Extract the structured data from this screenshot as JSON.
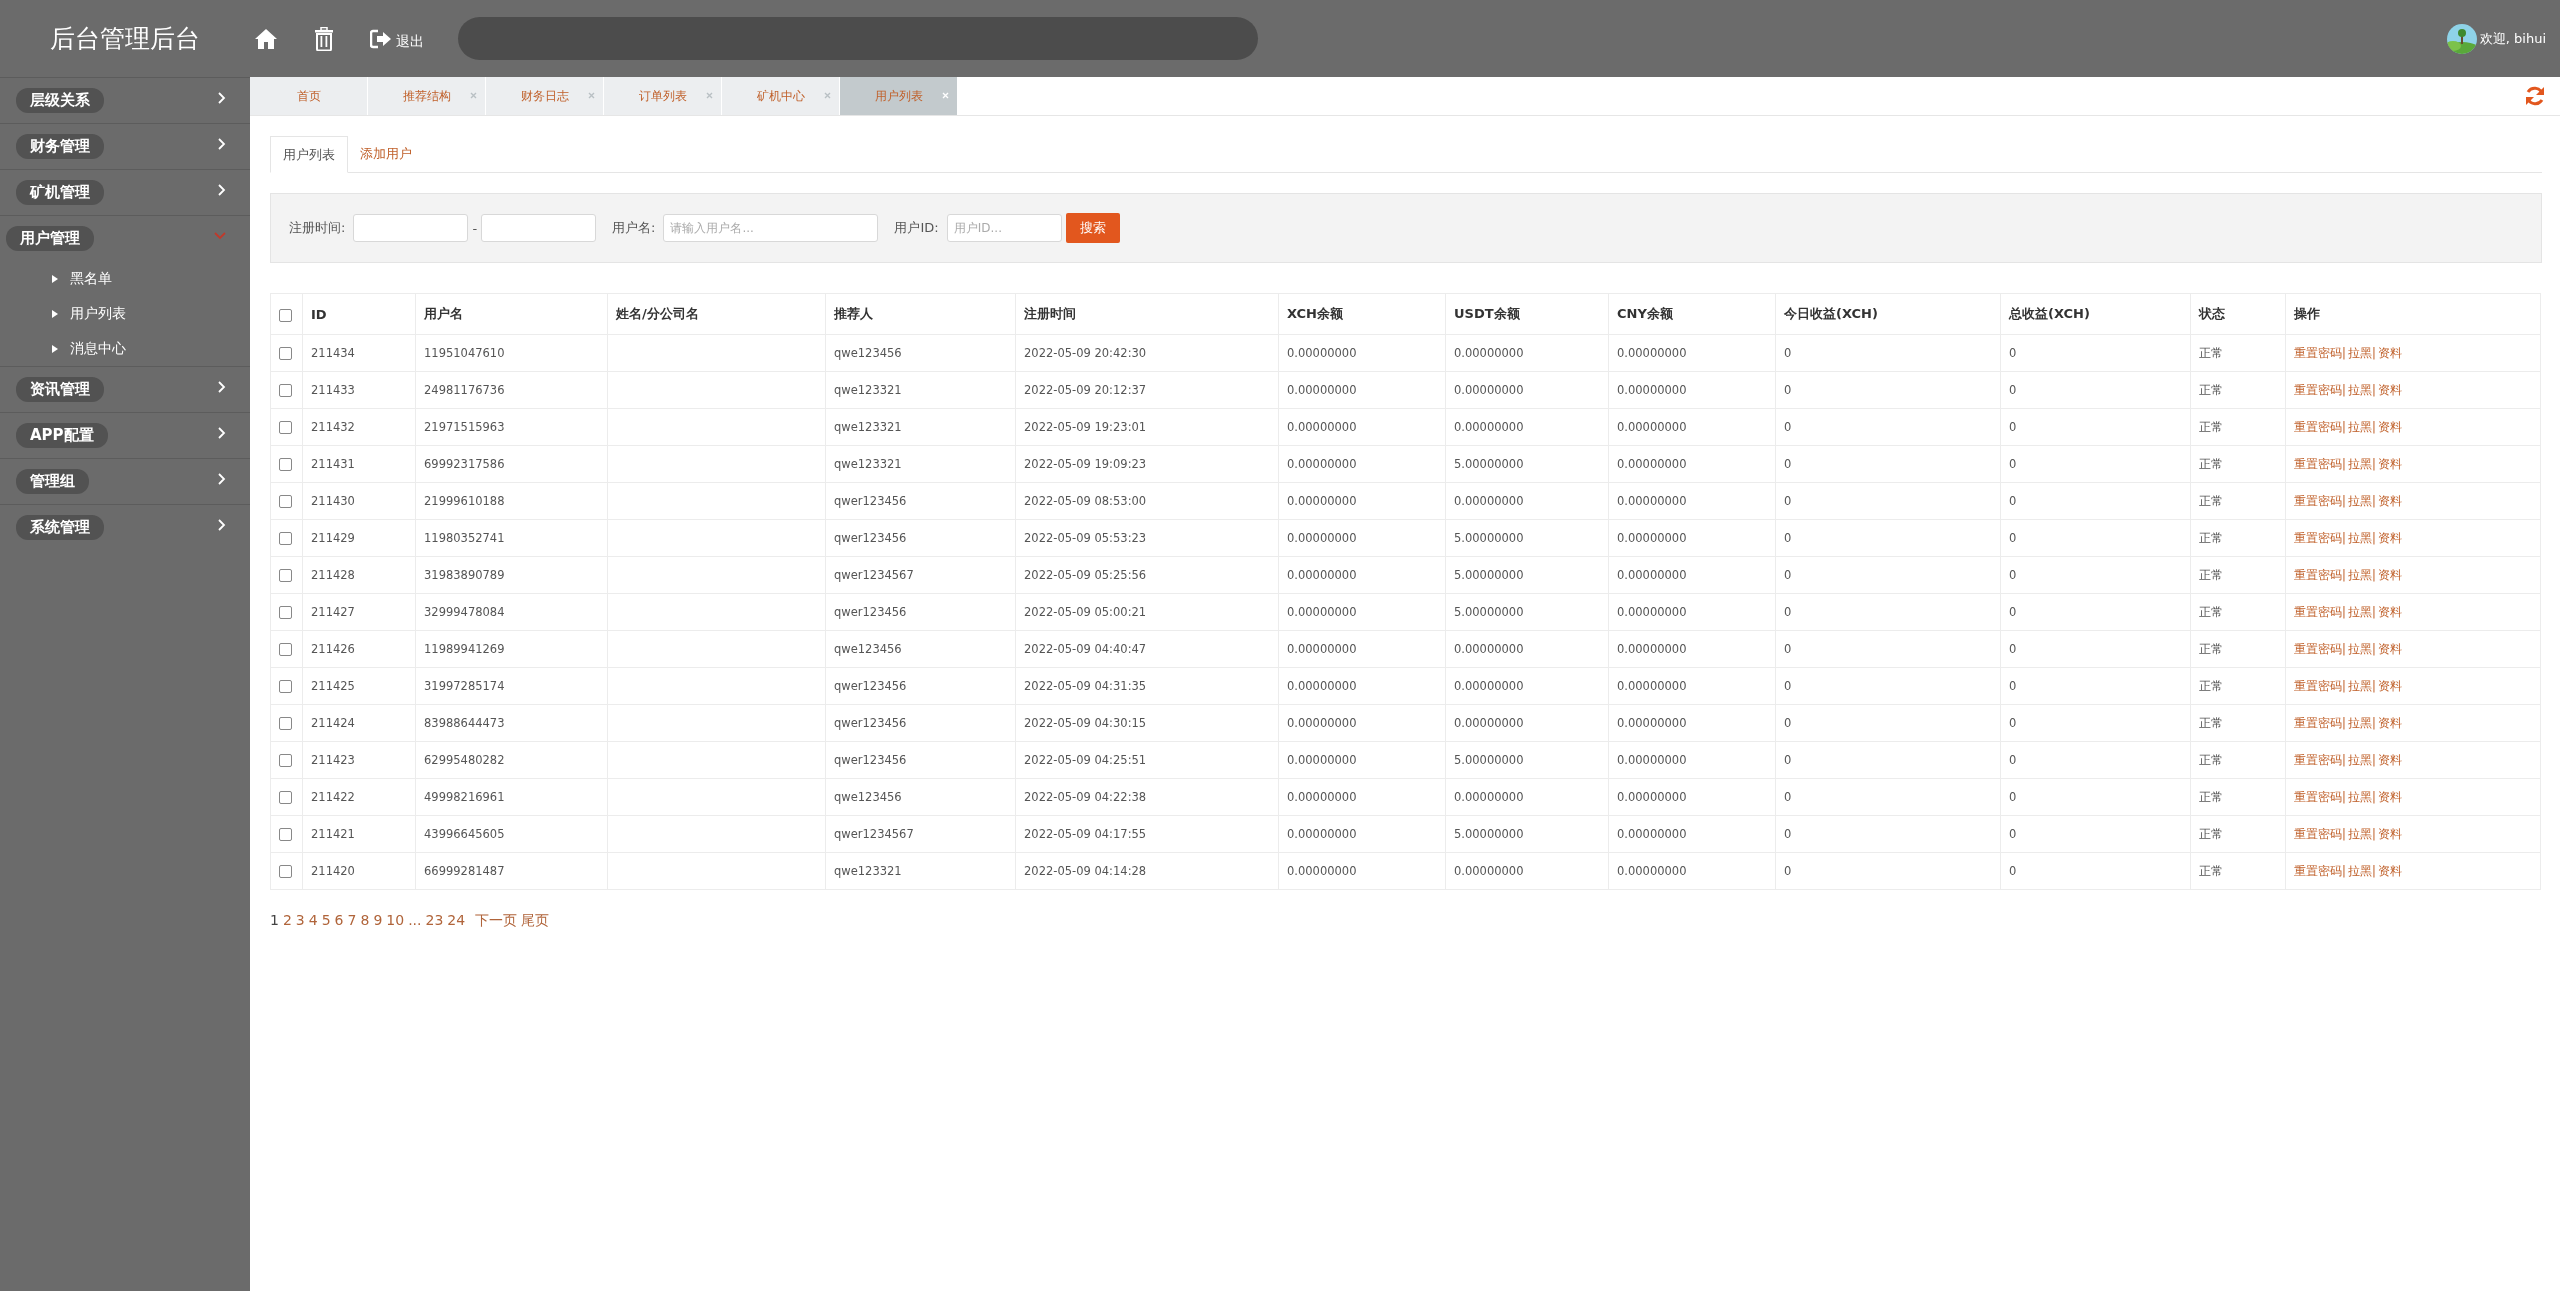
{
  "header": {
    "title": "后台管理后台",
    "logout": "退出",
    "user": "欢迎, bihui"
  },
  "sidebar": {
    "items": [
      {
        "label": "层级关系",
        "expanded": false
      },
      {
        "label": "财务管理",
        "expanded": false
      },
      {
        "label": "矿机管理",
        "expanded": false
      },
      {
        "label": "用户管理",
        "expanded": true,
        "children": [
          {
            "label": "黑名单"
          },
          {
            "label": "用户列表"
          },
          {
            "label": "消息中心"
          }
        ]
      },
      {
        "label": "资讯管理",
        "expanded": false
      },
      {
        "label": "APP配置",
        "expanded": false
      },
      {
        "label": "管理组",
        "expanded": false
      },
      {
        "label": "系统管理",
        "expanded": false
      }
    ]
  },
  "page_tabs": [
    {
      "label": "首页",
      "selected": false,
      "closable": false
    },
    {
      "label": "推荐结构",
      "selected": false,
      "closable": true
    },
    {
      "label": "财务日志",
      "selected": false,
      "closable": true
    },
    {
      "label": "订单列表",
      "selected": false,
      "closable": true
    },
    {
      "label": "矿机中心",
      "selected": false,
      "closable": true
    },
    {
      "label": "用户列表",
      "selected": true,
      "closable": true
    }
  ],
  "sub_tabs": [
    {
      "label": "用户列表",
      "selected": true
    },
    {
      "label": "添加用户",
      "selected": false
    }
  ],
  "filters": {
    "date_label": "注册时间:",
    "date_sep": "-",
    "name_label": "用户名:",
    "name_placeholder": "请输入用户名...",
    "id_label": "用户ID:",
    "id_placeholder": "用户ID...",
    "search": "搜索"
  },
  "table": {
    "all_checked": false,
    "columns": [
      "ID",
      "用户名",
      "姓名/分公司名",
      "推荐人",
      "注册时间",
      "XCH余额",
      "USDT余额",
      "CNY余额",
      "今日收益(XCH)",
      "总收益(XCH)",
      "状态",
      "操作"
    ],
    "rows": [
      {
        "checked": false,
        "cells": [
          "211434",
          "11951047610",
          "",
          "qwe123456",
          "2022-05-09 20:42:30",
          "0.00000000",
          "0.00000000",
          "0.00000000",
          "0",
          "0",
          "正常"
        ],
        "actions": [
          "重置密码|",
          "拉黑|",
          "资料"
        ]
      },
      {
        "checked": false,
        "cells": [
          "211433",
          "24981176736",
          "",
          "qwe123321",
          "2022-05-09 20:12:37",
          "0.00000000",
          "0.00000000",
          "0.00000000",
          "0",
          "0",
          "正常"
        ],
        "actions": [
          "重置密码|",
          "拉黑|",
          "资料"
        ]
      },
      {
        "checked": false,
        "cells": [
          "211432",
          "21971515963",
          "",
          "qwe123321",
          "2022-05-09 19:23:01",
          "0.00000000",
          "0.00000000",
          "0.00000000",
          "0",
          "0",
          "正常"
        ],
        "actions": [
          "重置密码|",
          "拉黑|",
          "资料"
        ]
      },
      {
        "checked": false,
        "cells": [
          "211431",
          "69992317586",
          "",
          "qwe123321",
          "2022-05-09 19:09:23",
          "0.00000000",
          "5.00000000",
          "0.00000000",
          "0",
          "0",
          "正常"
        ],
        "actions": [
          "重置密码|",
          "拉黑|",
          "资料"
        ]
      },
      {
        "checked": false,
        "cells": [
          "211430",
          "21999610188",
          "",
          "qwer123456",
          "2022-05-09 08:53:00",
          "0.00000000",
          "0.00000000",
          "0.00000000",
          "0",
          "0",
          "正常"
        ],
        "actions": [
          "重置密码|",
          "拉黑|",
          "资料"
        ]
      },
      {
        "checked": false,
        "cells": [
          "211429",
          "11980352741",
          "",
          "qwer123456",
          "2022-05-09 05:53:23",
          "0.00000000",
          "5.00000000",
          "0.00000000",
          "0",
          "0",
          "正常"
        ],
        "actions": [
          "重置密码|",
          "拉黑|",
          "资料"
        ]
      },
      {
        "checked": false,
        "cells": [
          "211428",
          "31983890789",
          "",
          "qwer1234567",
          "2022-05-09 05:25:56",
          "0.00000000",
          "5.00000000",
          "0.00000000",
          "0",
          "0",
          "正常"
        ],
        "actions": [
          "重置密码|",
          "拉黑|",
          "资料"
        ]
      },
      {
        "checked": false,
        "cells": [
          "211427",
          "32999478084",
          "",
          "qwer123456",
          "2022-05-09 05:00:21",
          "0.00000000",
          "5.00000000",
          "0.00000000",
          "0",
          "0",
          "正常"
        ],
        "actions": [
          "重置密码|",
          "拉黑|",
          "资料"
        ]
      },
      {
        "checked": false,
        "cells": [
          "211426",
          "11989941269",
          "",
          "qwe123456",
          "2022-05-09 04:40:47",
          "0.00000000",
          "0.00000000",
          "0.00000000",
          "0",
          "0",
          "正常"
        ],
        "actions": [
          "重置密码|",
          "拉黑|",
          "资料"
        ]
      },
      {
        "checked": false,
        "cells": [
          "211425",
          "31997285174",
          "",
          "qwer123456",
          "2022-05-09 04:31:35",
          "0.00000000",
          "0.00000000",
          "0.00000000",
          "0",
          "0",
          "正常"
        ],
        "actions": [
          "重置密码|",
          "拉黑|",
          "资料"
        ]
      },
      {
        "checked": false,
        "cells": [
          "211424",
          "83988644473",
          "",
          "qwer123456",
          "2022-05-09 04:30:15",
          "0.00000000",
          "0.00000000",
          "0.00000000",
          "0",
          "0",
          "正常"
        ],
        "actions": [
          "重置密码|",
          "拉黑|",
          "资料"
        ]
      },
      {
        "checked": false,
        "cells": [
          "211423",
          "62995480282",
          "",
          "qwer123456",
          "2022-05-09 04:25:51",
          "0.00000000",
          "5.00000000",
          "0.00000000",
          "0",
          "0",
          "正常"
        ],
        "actions": [
          "重置密码|",
          "拉黑|",
          "资料"
        ]
      },
      {
        "checked": false,
        "cells": [
          "211422",
          "49998216961",
          "",
          "qwe123456",
          "2022-05-09 04:22:38",
          "0.00000000",
          "0.00000000",
          "0.00000000",
          "0",
          "0",
          "正常"
        ],
        "actions": [
          "重置密码|",
          "拉黑|",
          "资料"
        ]
      },
      {
        "checked": false,
        "cells": [
          "211421",
          "43996645605",
          "",
          "qwer1234567",
          "2022-05-09 04:17:55",
          "0.00000000",
          "5.00000000",
          "0.00000000",
          "0",
          "0",
          "正常"
        ],
        "actions": [
          "重置密码|",
          "拉黑|",
          "资料"
        ]
      },
      {
        "checked": false,
        "cells": [
          "211420",
          "66999281487",
          "",
          "qwe123321",
          "2022-05-09 04:14:28",
          "0.00000000",
          "0.00000000",
          "0.00000000",
          "0",
          "0",
          "正常"
        ],
        "actions": [
          "重置密码|",
          "拉黑|",
          "资料"
        ]
      }
    ]
  },
  "pagination": {
    "pages": [
      {
        "label": "1",
        "selected": true
      },
      {
        "label": "2",
        "selected": false
      },
      {
        "label": "3",
        "selected": false
      },
      {
        "label": "4",
        "selected": false
      },
      {
        "label": "5",
        "selected": false
      },
      {
        "label": "6",
        "selected": false
      },
      {
        "label": "7",
        "selected": false
      },
      {
        "label": "8",
        "selected": false
      },
      {
        "label": "9",
        "selected": false
      },
      {
        "label": "10",
        "selected": false
      },
      {
        "label": "...",
        "selected": false
      },
      {
        "label": "23",
        "selected": false
      },
      {
        "label": "24",
        "selected": false
      }
    ],
    "next": "下一页",
    "last": "尾页"
  }
}
